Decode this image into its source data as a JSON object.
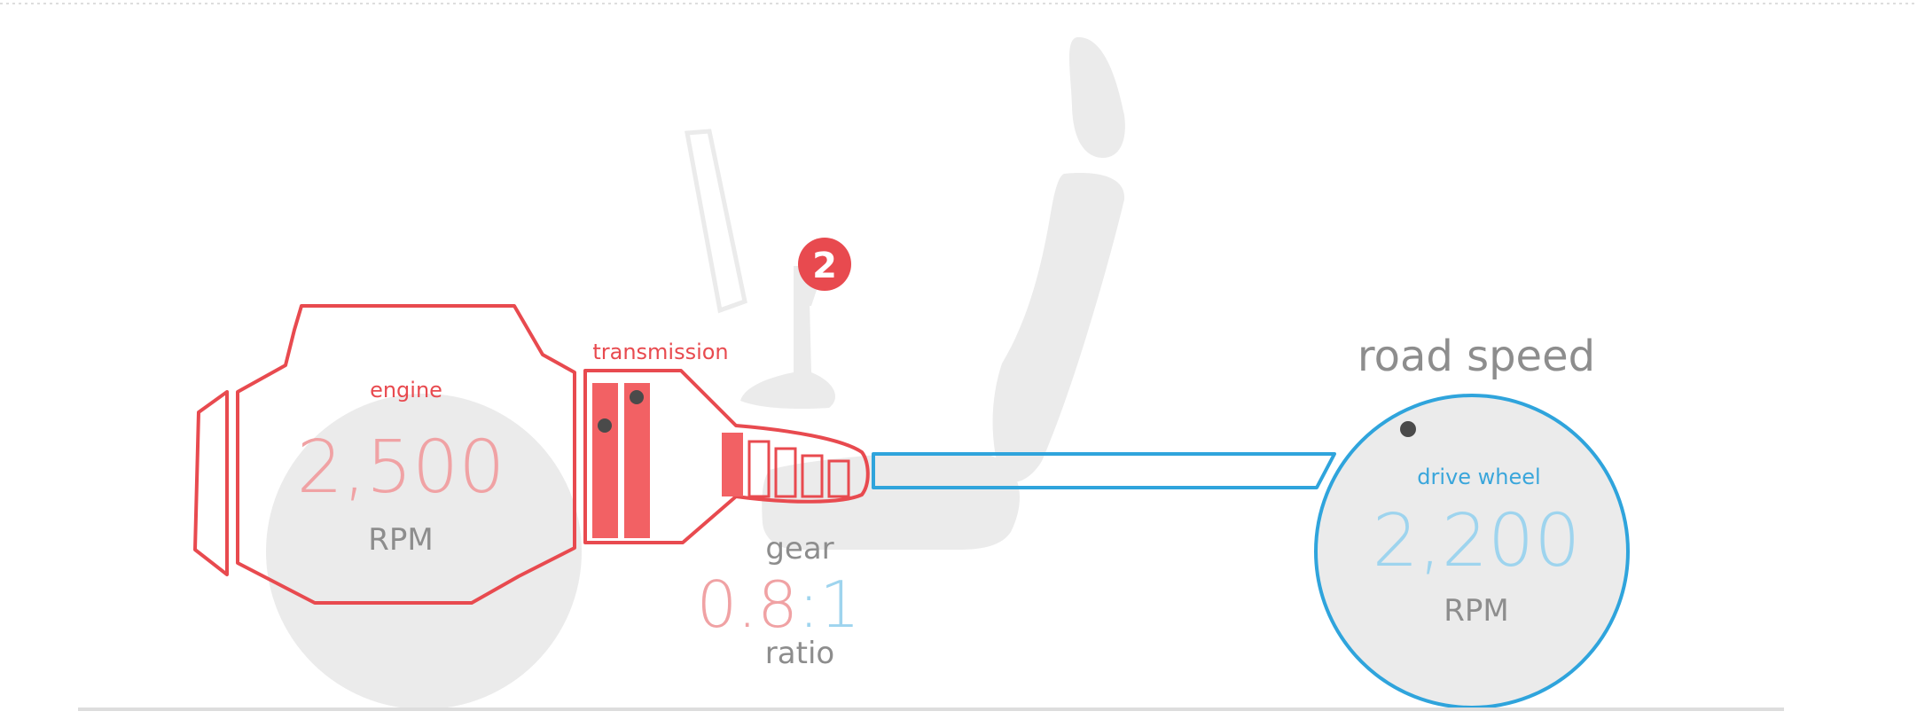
{
  "diagram": {
    "engine": {
      "label": "engine",
      "value": "2,500",
      "unit": "RPM"
    },
    "transmission": {
      "label": "transmission"
    },
    "gear_badge": "2",
    "gear": {
      "label_top": "gear",
      "ratio_left": "0.8",
      "ratio_right": ":1",
      "label_bottom": "ratio"
    },
    "road_speed": {
      "title": "road speed",
      "wheel_label": "drive wheel",
      "value": "2,200",
      "unit": "RPM"
    }
  },
  "colors": {
    "engine_red": "#e84a4f",
    "engine_fill": "#f26164",
    "value_red": "#f0a2a4",
    "wheel_blue": "#2fa4dc",
    "value_blue": "#9ed4ee",
    "silhouette_gray": "#ebebeb",
    "text_gray": "#8d8d8d",
    "dot_dark": "#4a4a4a"
  }
}
